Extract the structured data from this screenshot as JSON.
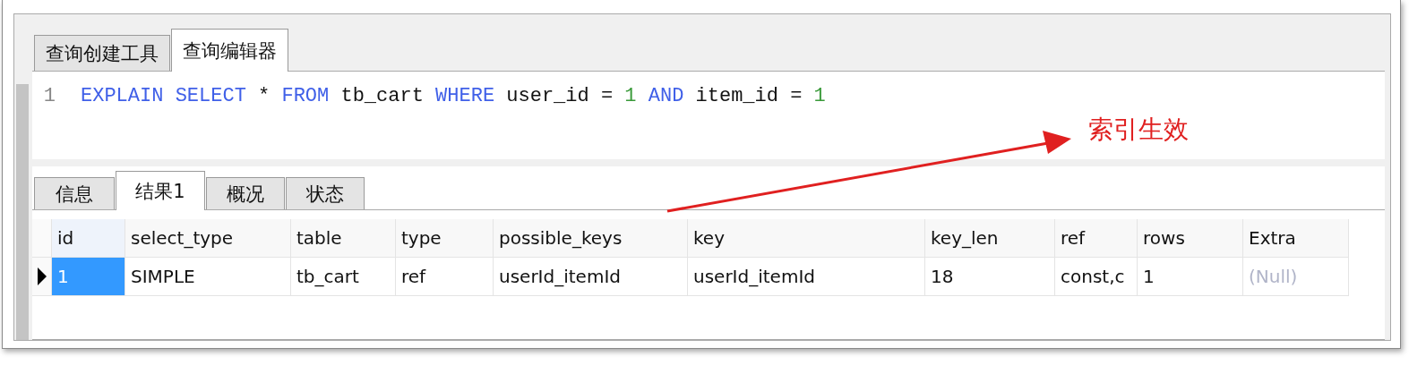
{
  "query_tabs": [
    {
      "label": "查询创建工具",
      "selected": false
    },
    {
      "label": "查询编辑器",
      "selected": true
    }
  ],
  "editor": {
    "lines": [
      {
        "number": "1",
        "tokens": [
          {
            "text": "EXPLAIN",
            "kind": "keyword"
          },
          {
            "text": "SELECT",
            "kind": "keyword"
          },
          {
            "text": "*",
            "kind": "plain"
          },
          {
            "text": "FROM",
            "kind": "keyword"
          },
          {
            "text": "tb_cart",
            "kind": "plain"
          },
          {
            "text": "WHERE",
            "kind": "keyword"
          },
          {
            "text": "user_id",
            "kind": "plain"
          },
          {
            "text": "=",
            "kind": "plain"
          },
          {
            "text": "1",
            "kind": "number"
          },
          {
            "text": "AND",
            "kind": "keyword"
          },
          {
            "text": "item_id",
            "kind": "plain"
          },
          {
            "text": "=",
            "kind": "plain"
          },
          {
            "text": "1",
            "kind": "number"
          }
        ]
      }
    ]
  },
  "annotation": {
    "text": "索引生效"
  },
  "result_tabs": [
    {
      "label": "信息",
      "selected": false
    },
    {
      "label": "结果1",
      "selected": true
    },
    {
      "label": "概况",
      "selected": false
    },
    {
      "label": "状态",
      "selected": false
    }
  ],
  "table": {
    "columns": [
      "id",
      "select_type",
      "table",
      "type",
      "possible_keys",
      "key",
      "key_len",
      "ref",
      "rows",
      "Extra"
    ],
    "rows": [
      {
        "current": true,
        "cells": [
          {
            "text": "1",
            "kind": "value"
          },
          {
            "text": "SIMPLE",
            "kind": "value"
          },
          {
            "text": "tb_cart",
            "kind": "value"
          },
          {
            "text": "ref",
            "kind": "value"
          },
          {
            "text": "userId_itemId",
            "kind": "value"
          },
          {
            "text": "userId_itemId",
            "kind": "value"
          },
          {
            "text": "18",
            "kind": "value"
          },
          {
            "text": "const,c",
            "kind": "value"
          },
          {
            "text": "1",
            "kind": "value"
          },
          {
            "text": "(Null)",
            "kind": "null"
          }
        ]
      }
    ]
  }
}
